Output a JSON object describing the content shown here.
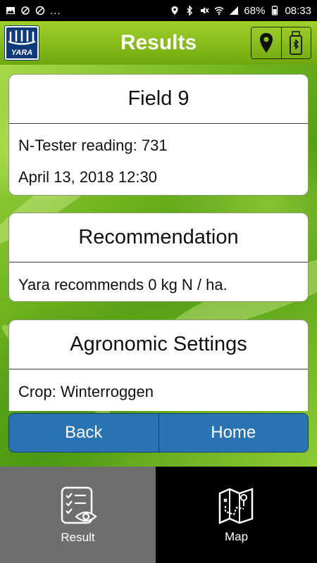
{
  "status_bar": {
    "battery": "68%",
    "time": "08:33",
    "more": "..."
  },
  "app_bar": {
    "title": "Results",
    "logo_text": "YARA",
    "actions": [
      "location-pin-icon",
      "bluetooth-usb-icon"
    ]
  },
  "field_card": {
    "title": "Field 9",
    "reading": "N-Tester reading: 731",
    "date": "April 13, 2018 12:30"
  },
  "recommendation_card": {
    "title": "Recommendation",
    "text": "Yara recommends 0 kg N / ha."
  },
  "agronomic_card": {
    "title": "Agronomic Settings",
    "crop": "Crop: Winterroggen"
  },
  "buttons": {
    "back": "Back",
    "home": "Home"
  },
  "tabs": [
    {
      "label": "Result",
      "icon": "checklist-eye-icon",
      "active": true
    },
    {
      "label": "Map",
      "icon": "map-icon",
      "active": false
    }
  ],
  "colors": {
    "accent_green": "#86bb1b",
    "button_blue": "#2a74b4",
    "tab_active": "#6e6e6e",
    "yara_blue": "#0d3b7a"
  }
}
